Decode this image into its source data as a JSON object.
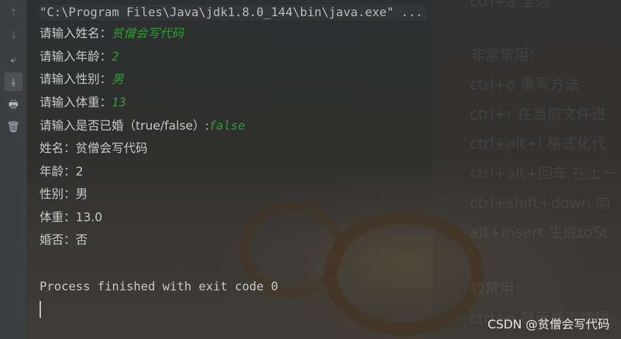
{
  "gutter": {
    "buttons": [
      {
        "icon": "up-arrow-icon",
        "glyph": "↑"
      },
      {
        "icon": "down-arrow-icon",
        "glyph": "↓"
      },
      {
        "icon": "soft-wrap-icon",
        "glyph": "⤶"
      },
      {
        "icon": "scroll-to-end-icon",
        "glyph": "⤓"
      },
      {
        "icon": "print-icon",
        "glyph": "🖶"
      },
      {
        "icon": "trash-icon",
        "glyph": "🗑"
      }
    ]
  },
  "console": {
    "command": "\"C:\\Program Files\\Java\\jdk1.8.0_144\\bin\\java.exe\" ...",
    "prompts": [
      {
        "label": "请输入姓名：",
        "value": "贫僧会写代码"
      },
      {
        "label": "请输入年龄：",
        "value": "2"
      },
      {
        "label": "请输入性别：",
        "value": "男"
      },
      {
        "label": "请输入体重：",
        "value": "13"
      },
      {
        "label": "请输入是否已婚（true/false）:",
        "value": "false"
      }
    ],
    "outputs": [
      "姓名：贫僧会写代码",
      "年龄：2",
      "性别：男",
      "体重：13.0",
      "婚否：否"
    ],
    "exit_message": "Process finished with exit code 0"
  },
  "background_notes": [
    "ctrl+a 全选",
    "非常常用：",
    "ctrl+o 重写方法",
    "ctrl+r 在当前文件进",
    "ctrl+alt+l 格式化代",
    "ctrl+alt+回车 在上一",
    "ctrl+shift+down 向",
    "alt+insert 生成toSt",
    "较常用：",
    "ctrl+e 显示最近编辑"
  ],
  "credit": "CSDN @贫僧会写代码"
}
